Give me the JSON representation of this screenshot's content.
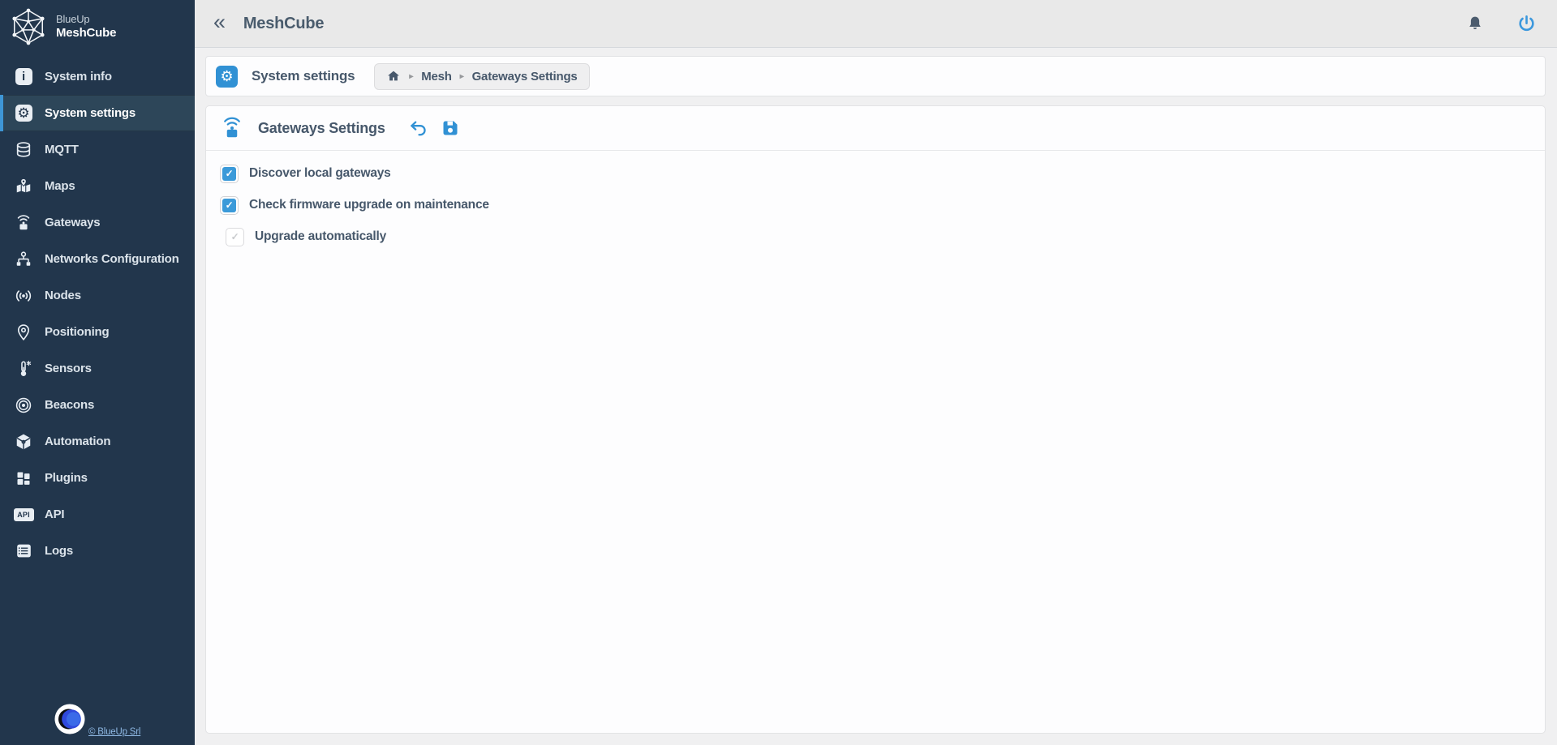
{
  "topbar": {
    "title": "MeshCube",
    "collapse_glyph": "«"
  },
  "sidebar": {
    "brand_line1": "BlueUp",
    "brand_line2": "MeshCube",
    "items": [
      {
        "label": "System info"
      },
      {
        "label": "System settings"
      },
      {
        "label": "MQTT"
      },
      {
        "label": "Maps"
      },
      {
        "label": "Gateways"
      },
      {
        "label": "Networks Configuration"
      },
      {
        "label": "Nodes"
      },
      {
        "label": "Positioning"
      },
      {
        "label": "Sensors"
      },
      {
        "label": "Beacons"
      },
      {
        "label": "Automation"
      },
      {
        "label": "Plugins"
      },
      {
        "label": "API"
      },
      {
        "label": "Logs"
      }
    ],
    "footer_link_label": "© BlueUp Srl"
  },
  "breadcrumb": {
    "section_title": "System settings",
    "crumb1": "Mesh",
    "crumb2": "Gateways Settings",
    "separator": "▸"
  },
  "panel": {
    "title": "Gateways Settings",
    "check_glyph": "✓",
    "checkboxes": [
      {
        "label": "Discover local gateways",
        "state": "checked"
      },
      {
        "label": "Check firmware upgrade on maintenance",
        "state": "checked"
      },
      {
        "label": "Upgrade automatically",
        "state": "checked-disabled"
      }
    ]
  },
  "icons": {
    "gear_glyph": "⚙",
    "info_glyph": "i",
    "api_label": "API"
  },
  "colors": {
    "sidebar-bg": "#22364c",
    "sidebar-active-bg": "#2d4659",
    "accent-blue": "#3191d4",
    "checkbox-blue": "#3b9ad9",
    "power-blue": "#3c98dd",
    "topbar-bg": "#e9e9e9",
    "content-bg": "#f0f0f1",
    "card-bg": "#fdfdfe",
    "slate-text": "#47586b"
  }
}
